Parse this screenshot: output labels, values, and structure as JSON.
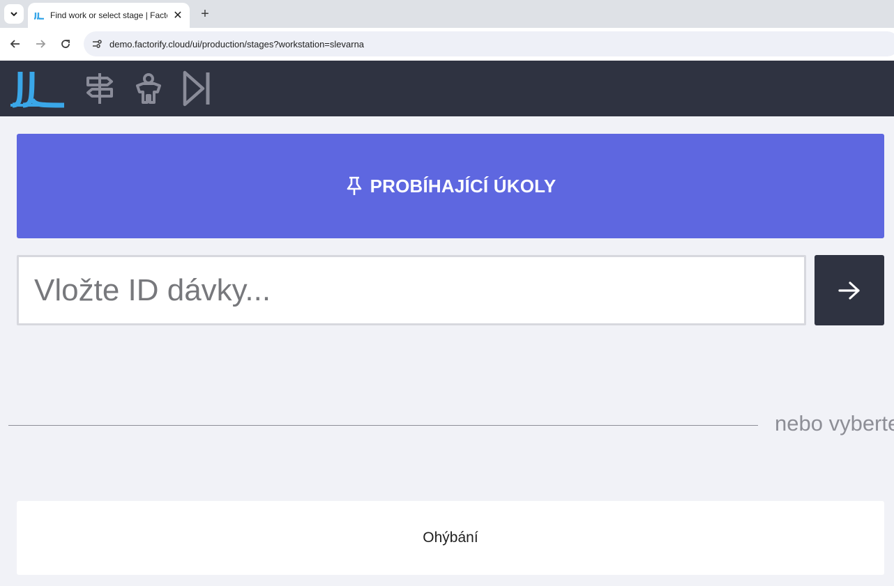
{
  "browser": {
    "tab_title": "Find work or select stage | Factorify",
    "tab_close": "✕",
    "new_tab": "+",
    "url": "demo.factorify.cloud/ui/production/stages?workstation=slevarna"
  },
  "header": {
    "icons": [
      "factorify-logo",
      "signpost-icon",
      "worker-icon",
      "skip-forward-icon"
    ],
    "colors": {
      "background": "#2f3341",
      "logo": "#3aa7e8",
      "icon": "#8a8c99"
    }
  },
  "main": {
    "running_tasks_label": "PROBÍHAJÍCÍ ÚKOLY",
    "batch_input_placeholder": "Vložte ID dávky...",
    "or_select_text": "nebo vyberte",
    "stages": [
      {
        "label": "Ohýbání"
      }
    ],
    "colors": {
      "primary": "#5e67e0",
      "dark": "#2f3341"
    }
  }
}
